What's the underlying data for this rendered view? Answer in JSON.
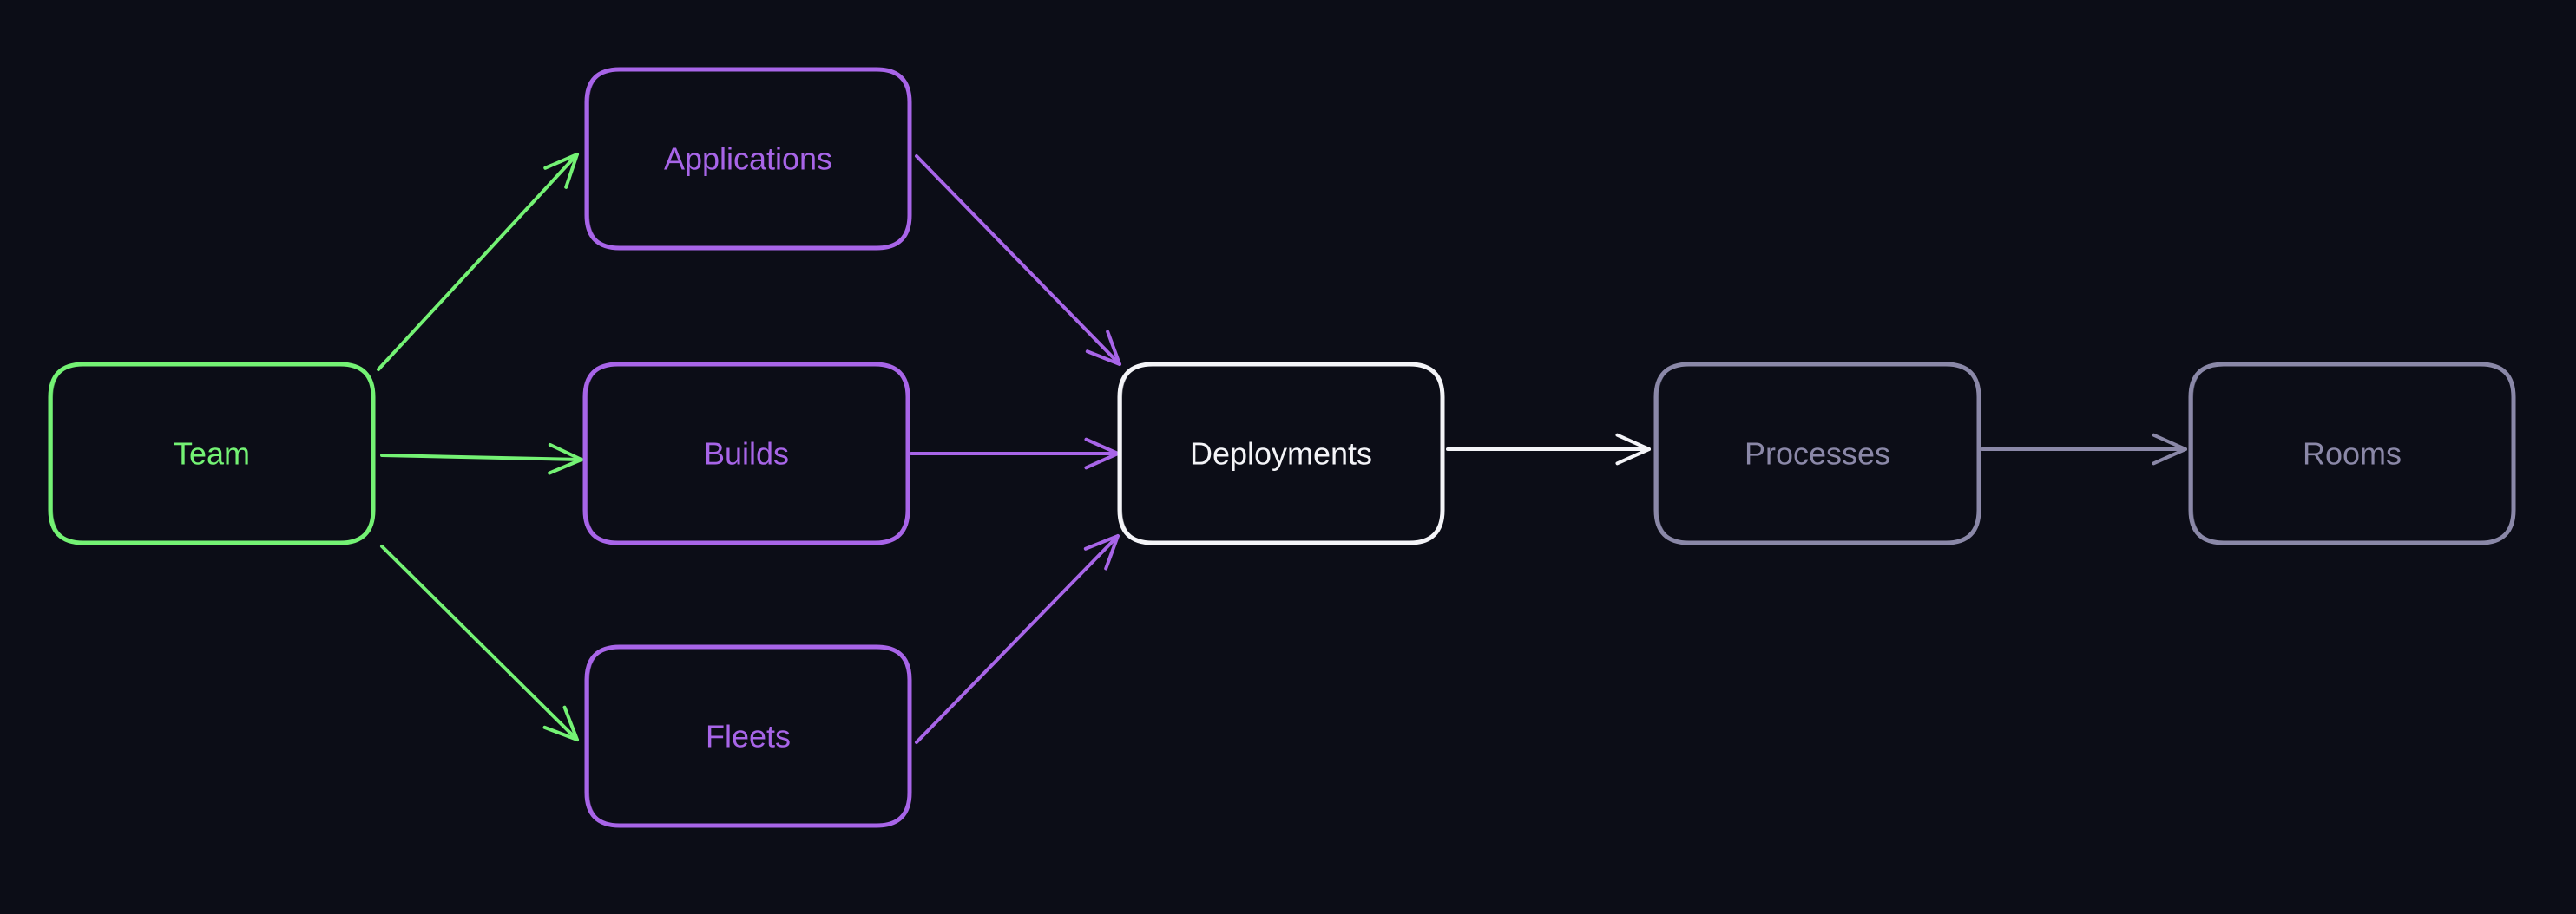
{
  "diagram": {
    "background": "#0c0d17",
    "colors": {
      "team": "#74f274",
      "resource": "#a865e8",
      "deployment": "#f4f4f8",
      "runtime": "#8b88a8"
    },
    "nodes": [
      {
        "id": "team",
        "label": "Team",
        "color_key": "team"
      },
      {
        "id": "applications",
        "label": "Applications",
        "color_key": "resource"
      },
      {
        "id": "builds",
        "label": "Builds",
        "color_key": "resource"
      },
      {
        "id": "fleets",
        "label": "Fleets",
        "color_key": "resource"
      },
      {
        "id": "deployments",
        "label": "Deployments",
        "color_key": "deployment"
      },
      {
        "id": "processes",
        "label": "Processes",
        "color_key": "runtime"
      },
      {
        "id": "rooms",
        "label": "Rooms",
        "color_key": "runtime"
      }
    ],
    "edges": [
      {
        "from": "team",
        "to": "applications",
        "color_key": "team"
      },
      {
        "from": "team",
        "to": "builds",
        "color_key": "team"
      },
      {
        "from": "team",
        "to": "fleets",
        "color_key": "team"
      },
      {
        "from": "applications",
        "to": "deployments",
        "color_key": "resource"
      },
      {
        "from": "builds",
        "to": "deployments",
        "color_key": "resource"
      },
      {
        "from": "fleets",
        "to": "deployments",
        "color_key": "resource"
      },
      {
        "from": "deployments",
        "to": "processes",
        "color_key": "deployment"
      },
      {
        "from": "processes",
        "to": "rooms",
        "color_key": "runtime"
      }
    ]
  }
}
